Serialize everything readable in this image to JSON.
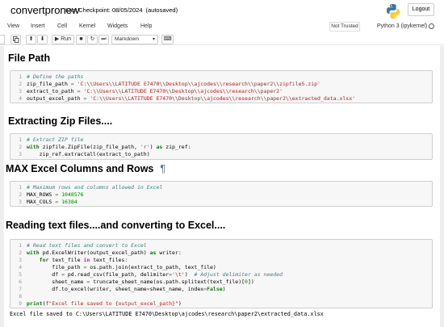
{
  "header": {
    "notebook_name": "convertpronew",
    "checkpoint": "Last Checkpoint: 08/05/2024",
    "autosave": "(autosaved)",
    "logout": "Logout"
  },
  "menubar": {
    "items": [
      "View",
      "Insert",
      "Cell",
      "Kernel",
      "Widgets",
      "Help"
    ],
    "trusted": "Not Trusted",
    "kernel": "Python 3 (ipykernel)"
  },
  "toolbar": {
    "run_label": "Run",
    "cell_type": "Markdown"
  },
  "cells": {
    "h1": "File Path",
    "code1": [
      "# Define the paths",
      "zip_file_path = 'C:\\\\Users\\\\LATITUDE E7470\\\\Desktop\\\\ajcodes\\\\research\\\\paper2\\\\zipfile5.zip'",
      "extract_to_path = 'C:\\\\Users\\\\LATITUDE E7470\\\\Desktop\\\\ajcodes\\\\research\\\\paper2'",
      "output_excel_path = 'C:\\\\Users\\\\LATITUDE E7470\\\\Desktop\\\\ajcodes\\\\research\\\\paper2\\\\extracted_data.xlsx'"
    ],
    "h2": "Extracting Zip Files....",
    "code2": [
      "# Extract ZIP file",
      "with zipfile.ZipFile(zip_file_path, 'r') as zip_ref:",
      "    zip_ref.extractall(extract_to_path)"
    ],
    "h3": "MAX Excel Columns and Rows",
    "pilcrow": "¶",
    "code3": [
      "# Maximum rows and columns allowed in Excel",
      "MAX_ROWS = 1048576",
      "MAX_COLS = 16384"
    ],
    "h4": "Reading text files....and converting to Excel....",
    "code4": [
      "# Read text files and convert to Excel",
      "with pd.ExcelWriter(output_excel_path) as writer:",
      "    for text_file in text_files:",
      "        file_path = os.path.join(extract_to_path, text_file)",
      "        df = pd.read_csv(file_path, delimiter='\\t')  # Adjust delimiter as needed",
      "        sheet_name = truncate_sheet_name(os.path.splitext(text_file)[0])",
      "        df.to_excel(writer, sheet_name=sheet_name, index=False)",
      "",
      "print(f\"Excel file saved to {output_excel_path}\")"
    ],
    "output": "Excel file saved to C:\\Users\\LATITUDE E7470\\Desktop\\ajcodes\\research\\paper2\\extracted_data.xlsx"
  }
}
